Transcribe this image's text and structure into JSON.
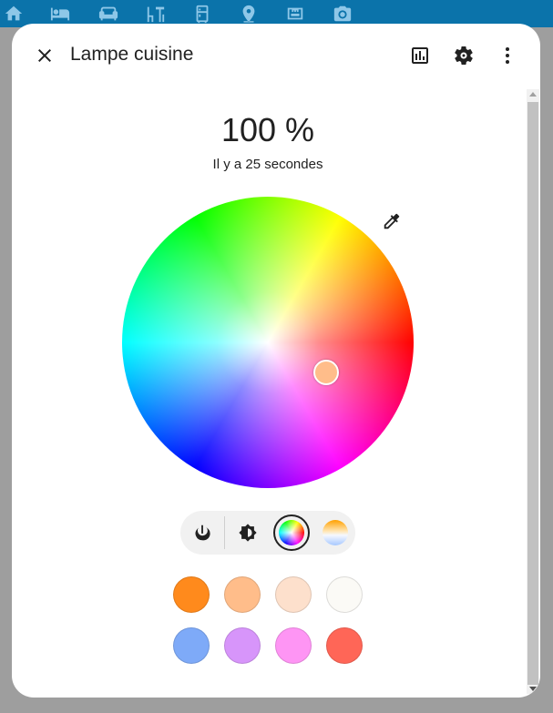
{
  "topbar": {
    "icons": [
      "home-icon",
      "bed-icon",
      "sofa-icon",
      "table-chair-icon",
      "fridge-icon",
      "map-pin-icon",
      "ethernet-icon",
      "camera-icon"
    ],
    "icon_color": "#8ec7e8",
    "background": "#0b73aa"
  },
  "dialog": {
    "title": "Lampe cuisine",
    "buttons": [
      "close-icon",
      "history-chart-icon",
      "gear-icon",
      "more-vertical-icon"
    ]
  },
  "light": {
    "brightness": "100 %",
    "last_changed": "Il y a 25 secondes",
    "selected_color": "#ffbd8a",
    "color_wheel_position": {
      "hue_degrees": 20,
      "saturation": 0.42
    }
  },
  "modes": [
    {
      "name": "power",
      "icon": "power-icon",
      "active": false
    },
    {
      "name": "brightness",
      "icon": "brightness-icon",
      "active": false
    },
    {
      "name": "color",
      "icon": "color-wheel-icon",
      "active": true
    },
    {
      "name": "color-temperature",
      "icon": "color-temperature-icon",
      "active": false
    }
  ],
  "favorite_colors": [
    [
      "#ff8a1c",
      "#ffbd8a",
      "#fde0cc",
      "#fbfaf6"
    ],
    [
      "#7eaaf8",
      "#d795fa",
      "#fe95f4",
      "#ff6657"
    ]
  ]
}
